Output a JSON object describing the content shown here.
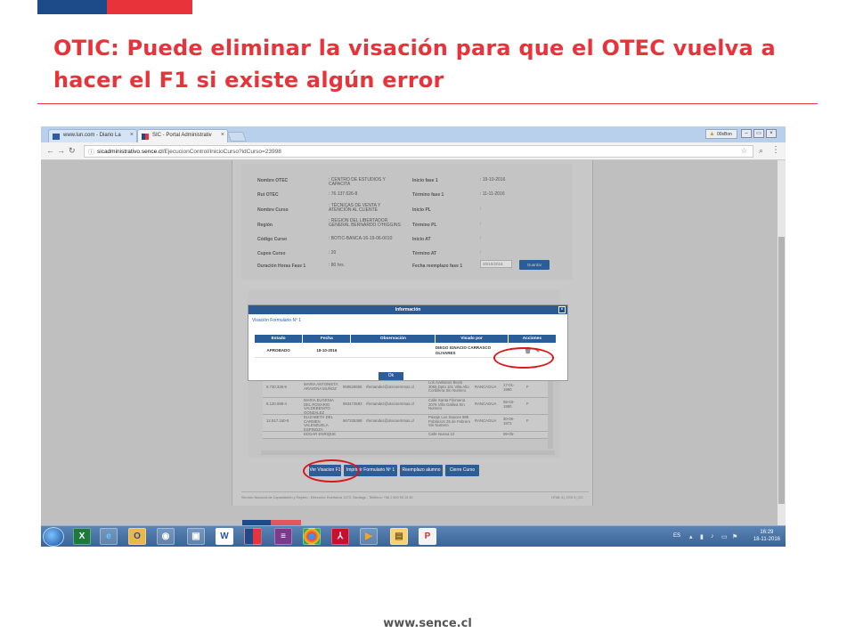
{
  "slide": {
    "title": "OTIC: Puede eliminar la visación para que el OTEC vuelva a hacer el F1 si existe algún error",
    "footer": "www.sence.cl",
    "colors": {
      "blue": "#1d4b8a",
      "red": "#e8333a",
      "annotation_ring": "#d9171e"
    }
  },
  "browser": {
    "tabs": [
      {
        "label": "www.lun.com - Diario La",
        "icon": "lun-favicon"
      },
      {
        "label": "SIC - Portal Administrativ",
        "icon": "sence-favicon",
        "active": true
      }
    ],
    "user_label": "00sBon",
    "url_host": "sicadministrativo.sence.cl",
    "url_path": "/EjecucionControl/InicioCurso?idCurso=23998"
  },
  "course_info": {
    "left": [
      {
        "label": "Nombre OTEC",
        "value": ": CENTRO DE ESTUDIOS Y CAPACITA"
      },
      {
        "label": "Rut OTEC",
        "value": ": 76.137.626-8"
      },
      {
        "label": "Nombre Curso",
        "value": ": TÉCNICAS DE VENTA Y ATENCIÓN AL CLIENTE"
      },
      {
        "label": "Región",
        "value": ": REGION DEL LIBERTADOR GENERAL BERNARDO O'HIGGINS"
      },
      {
        "label": "Código Curso",
        "value": ": BOTIC-BANCA-16-19-06-0010"
      },
      {
        "label": "Cupos Curso",
        "value": ": 20"
      },
      {
        "label": "Duración Horas Fase 1",
        "value": ": 80 hrs."
      }
    ],
    "right": [
      {
        "label": "Inicio fase 1",
        "value": ": 19-10-2016"
      },
      {
        "label": "Término fase 1",
        "value": ": 11-11-2016"
      },
      {
        "label": "Inicio PL",
        "value": ":"
      },
      {
        "label": "Término PL",
        "value": ":"
      },
      {
        "label": "Inicio AT",
        "value": ":"
      },
      {
        "label": "Término AT",
        "value": ":"
      },
      {
        "label": "Fecha reemplazo fase 1",
        "value": ""
      }
    ],
    "date_input": "20/10/2016",
    "save_button": "Guardar"
  },
  "participants_bg": [
    {
      "rut": "8.730.336-9",
      "name": "MARIA ANTONIETA ARAVENA MUÑOZ",
      "phone": "958628655",
      "email": "rfernandez@otecsernmas.cl",
      "address": "Los Avellanos Block 3065 Dpto 101 Villa Alto Cordillera Sin Numero",
      "city": "RANCAGUA",
      "date": "17-01-1960",
      "sex": "F"
    },
    {
      "rut": "8.120.988-4",
      "name": "MARIA EUGENIA DEL ROSARIO VALDEBENITO GONZALEZ",
      "phone": "983473583",
      "email": "rfernandez@otecsernmas.cl",
      "address": "Calle Santa Filomena 2076 Villa Galilea Sin Numero",
      "city": "RANCAGUA",
      "date": "08-03-1950",
      "sex": "F"
    },
    {
      "rut": "12.517.160-5",
      "name": "ELIZABETH DEL CARMEN VALENZUELA ESPINOZA",
      "phone": "967335368",
      "email": "rfernandez@otecsernmas.cl",
      "address": "Pasaje Los Sauces 985 Poblacion 25 de Febrero Sin Numero",
      "city": "RANCAGUA",
      "date": "30-06-1973",
      "sex": "F"
    },
    {
      "rut": "",
      "name": "EDGAR ENRIQUE",
      "phone": "",
      "email": "",
      "address": "Calle Nueva 12",
      "city": "",
      "date": "09-05-",
      "sex": ""
    }
  ],
  "actions": {
    "ver_visacion": "Ver Visacion F1",
    "imprimir": "Imprimir Formulario Nº 1",
    "reemplazo": "Reemplazo alumno",
    "cierre": "Cierre Curso"
  },
  "page_footer": {
    "left": "Servicio Nacional de Capacitación y Empleo - Dirección: Huérfanos 1273, Santiago - Teléfono: +56 2 600 90 10 30",
    "right": "HTML 5 | CSS 3 | CC"
  },
  "modal": {
    "title": "Información",
    "subtitle": "Visación Formulario Nº 1",
    "headers": [
      "Estado",
      "Fecha",
      "Observación",
      "Visado por",
      "Acciones"
    ],
    "row": {
      "estado": "APROBADO",
      "fecha": "18-10-2016",
      "observacion": "",
      "visado_por": "DIEGO IGNACIO CARRASCO OLIVARES",
      "icons": [
        "trash-icon",
        "pencil-icon"
      ]
    },
    "ok": "Ok"
  },
  "taskbar": {
    "apps": [
      "excel-icon",
      "ie-icon",
      "outlook-icon",
      "media-icon",
      "folder-icon",
      "word-icon",
      "sence-icon",
      "winrar-icon",
      "chrome-icon",
      "acrobat-icon",
      "media-player-icon",
      "explorer-icon",
      "paint-icon"
    ],
    "language": "ES",
    "time": "16:29",
    "date": "18-11-2016"
  }
}
